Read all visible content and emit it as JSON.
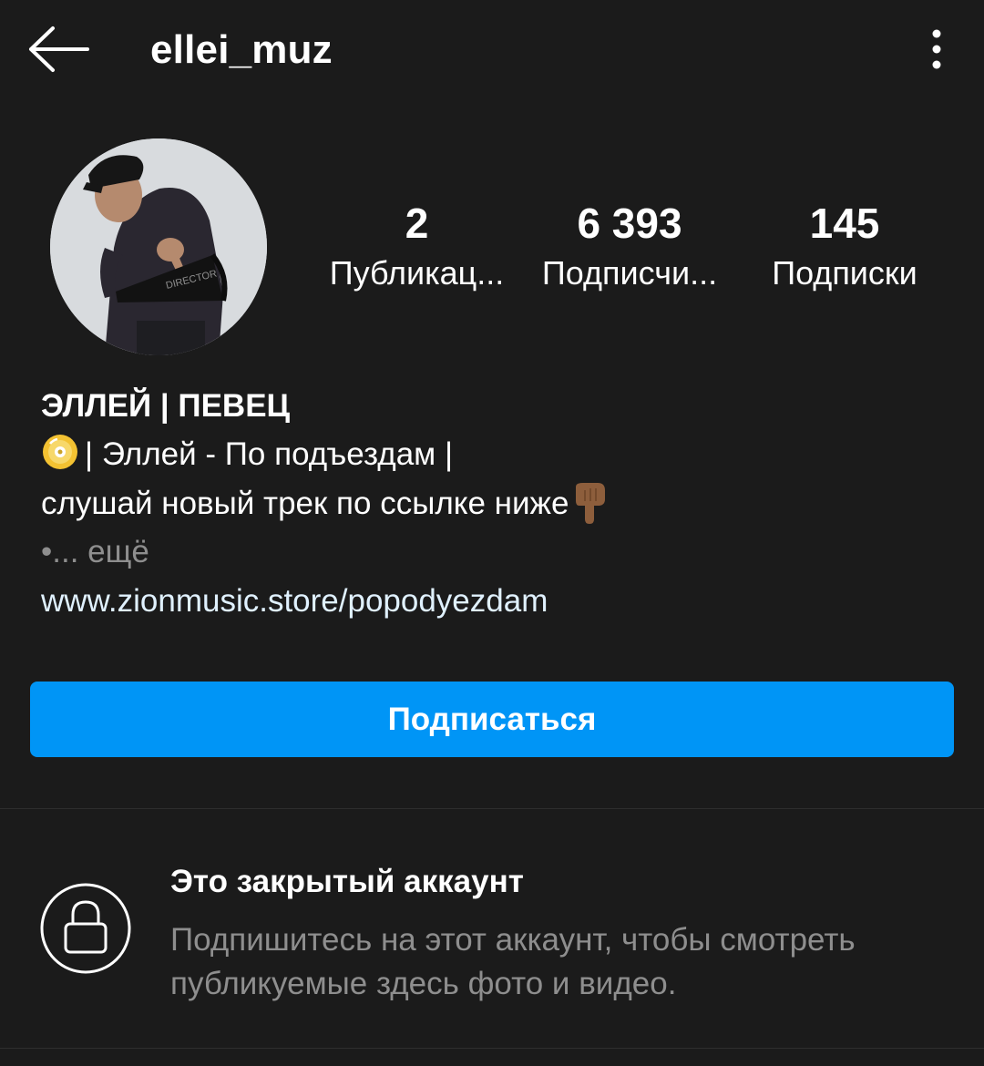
{
  "header": {
    "username": "ellei_muz",
    "back_icon": "arrow-left-icon",
    "menu_icon": "more-vertical-icon"
  },
  "profile": {
    "avatar_alt": "profile-avatar",
    "stats": {
      "posts": {
        "count": "2",
        "label": "Публикац..."
      },
      "followers": {
        "count": "6 393",
        "label": "Подписчи..."
      },
      "following": {
        "count": "145",
        "label": "Подписки"
      }
    }
  },
  "bio": {
    "name": "ЭЛЛЕЙ | ПЕВЕЦ",
    "line1_emoji": "dvd-disc-emoji",
    "line1": "| Эллей - По подъездам |",
    "line2": "слушай новый трек по ссылке ниже",
    "line2_emoji": "backhand-index-pointing-down-emoji",
    "more": "•... ещё",
    "link": "www.zionmusic.store/popodyezdam"
  },
  "actions": {
    "follow_label": "Подписаться"
  },
  "private_notice": {
    "icon": "lock-icon",
    "title": "Это закрытый аккаунт",
    "description": "Подпишитесь на этот аккаунт, чтобы смотреть публикуемые здесь фото и видео."
  },
  "colors": {
    "background": "#1b1b1b",
    "accent": "#0095f6",
    "secondary_text": "#8e8e8e",
    "link_text": "#e0f1ff"
  }
}
